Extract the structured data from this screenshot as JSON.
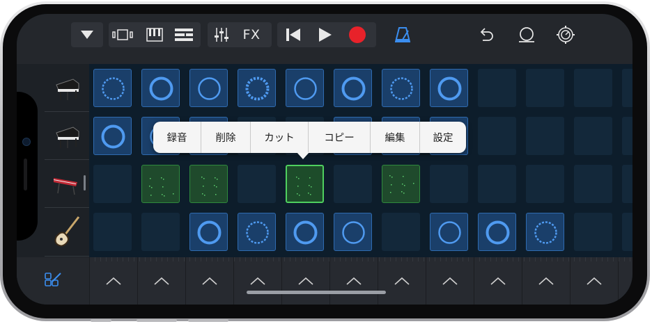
{
  "toolbar": {
    "icons": [
      "track-menu-icon",
      "track-view-icon",
      "keyboard-icon",
      "tracks-list-icon",
      "mixer-icon",
      "go-to-start-icon",
      "play-icon",
      "record-icon",
      "metronome-icon",
      "undo-icon",
      "loop-icon",
      "settings-icon"
    ],
    "fx_label": "FX",
    "record_color": "#e8222a",
    "metronome_color": "#3b8ef0"
  },
  "tracks": [
    {
      "instrument": "grand-piano",
      "cells": [
        "blue",
        "blue",
        "blue",
        "blue",
        "blue",
        "blue",
        "blue",
        "blue",
        "empty",
        "empty",
        "empty",
        "empty"
      ]
    },
    {
      "instrument": "grand-piano",
      "cells": [
        "blue",
        "blue",
        "blue",
        "empty",
        "empty",
        "blue",
        "blue",
        "blue",
        "empty",
        "empty",
        "empty",
        "empty"
      ]
    },
    {
      "instrument": "synth-keyboard",
      "cells": [
        "empty",
        "green",
        "green",
        "empty",
        "green-selected",
        "empty",
        "green",
        "empty",
        "empty",
        "empty",
        "empty",
        "empty"
      ]
    },
    {
      "instrument": "electric-guitar",
      "cells": [
        "empty",
        "empty",
        "blue",
        "blue",
        "blue",
        "blue",
        "empty",
        "blue",
        "blue",
        "blue",
        "empty",
        "empty"
      ]
    }
  ],
  "popup_menu": {
    "items": [
      "録音",
      "削除",
      "カット",
      "コピー",
      "編集",
      "設定"
    ]
  },
  "colors": {
    "cell_blue": "#1a3f6a",
    "cell_green": "#1f4a2c",
    "accent_blue": "#3b8ef0",
    "accent_green": "#4fd05f"
  }
}
